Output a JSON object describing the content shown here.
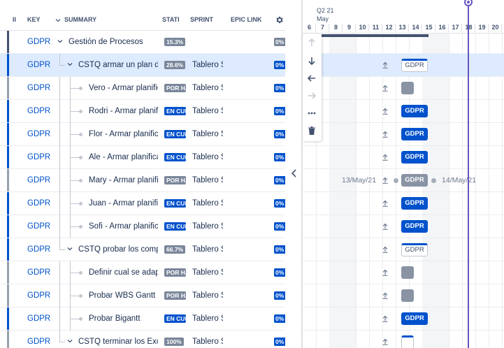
{
  "columns": {
    "first": "II",
    "key": "KEY",
    "summary": "SUMMARY",
    "status": "STATI",
    "sprint": "SPRINT",
    "epic_link": "EPIC LINK"
  },
  "rows": [
    {
      "key": "GDPR",
      "summary": "Gestión de Procesos",
      "status": "15.3%",
      "status_color": "gray",
      "sprint": "",
      "pct": "0%",
      "level": 0,
      "bar": "dark",
      "expanded": true
    },
    {
      "key": "GDPR",
      "summary": "CSTQ armar un plan de",
      "status": "28.6%",
      "status_color": "gray",
      "sprint": "Tablero S",
      "pct": "0%",
      "level": 1,
      "bar": "blue",
      "expanded": true,
      "selected": true
    },
    {
      "key": "GDPR",
      "summary": "Vero - Armar planific",
      "status": "POR HA",
      "status_color": "gray",
      "sprint": "Tablero S",
      "pct": "0%",
      "level": 2,
      "bar": "gray"
    },
    {
      "key": "GDPR",
      "summary": "Rodri - Armar planifi",
      "status": "EN CUI",
      "status_color": "blue",
      "sprint": "Tablero S",
      "pct": "0%",
      "level": 2,
      "bar": "blue"
    },
    {
      "key": "GDPR",
      "summary": "Flor - Armar planifica",
      "status": "EN CUI",
      "status_color": "blue",
      "sprint": "Tablero S",
      "pct": "0%",
      "level": 2,
      "bar": "blue"
    },
    {
      "key": "GDPR",
      "summary": "Ale - Armar planifica",
      "status": "EN CUI",
      "status_color": "blue",
      "sprint": "Tablero S",
      "pct": "0%",
      "level": 2,
      "bar": "blue"
    },
    {
      "key": "GDPR",
      "summary": "Mary - Armar planific",
      "status": "POR HA",
      "status_color": "gray",
      "sprint": "Tablero S",
      "pct": "0%",
      "level": 2,
      "bar": "gray"
    },
    {
      "key": "GDPR",
      "summary": "Juan - Armar planifi",
      "status": "EN CUI",
      "status_color": "blue",
      "sprint": "Tablero S",
      "pct": "0%",
      "level": 2,
      "bar": "blue"
    },
    {
      "key": "GDPR",
      "summary": "Sofi - Armar planific",
      "status": "EN CUI",
      "status_color": "blue",
      "sprint": "Tablero S",
      "pct": "0%",
      "level": 2,
      "bar": "blue"
    },
    {
      "key": "GDPR",
      "summary": "CSTQ probar los compl",
      "status": "66.7%",
      "status_color": "gray",
      "sprint": "Tablero S",
      "pct": "0%",
      "level": 1,
      "bar": "blue",
      "expanded": true
    },
    {
      "key": "GDPR",
      "summary": "Definir cual se adap",
      "status": "POR HA",
      "status_color": "gray",
      "sprint": "Tablero S",
      "pct": "0%",
      "level": 2,
      "bar": "gray"
    },
    {
      "key": "GDPR",
      "summary": "Probar WBS Gantt",
      "status": "POR HA",
      "status_color": "gray",
      "sprint": "Tablero S",
      "pct": "0%",
      "level": 2,
      "bar": "gray"
    },
    {
      "key": "GDPR",
      "summary": "Probar Bigantt",
      "status": "EN CUI",
      "status_color": "blue",
      "sprint": "Tablero S",
      "pct": "0%",
      "level": 2,
      "bar": "blue"
    },
    {
      "key": "GDPR",
      "summary": "CSTQ terminar los Exce",
      "status": "100%",
      "status_color": "gray",
      "sprint": "Tablero S",
      "pct": "0%",
      "level": 1,
      "bar": "gray",
      "expanded": true
    }
  ],
  "timeline": {
    "quarter": "Q2 21",
    "month": "May",
    "days": [
      "6",
      "7",
      "8",
      "9",
      "10",
      "11",
      "12",
      "13",
      "14",
      "15",
      "16",
      "17",
      "18",
      "19",
      "20"
    ],
    "weekend_days": [
      "8",
      "9",
      "15",
      "16"
    ],
    "today_day": "18",
    "bars": [
      {
        "row": 1,
        "label": "GDPR",
        "style": "outline"
      },
      {
        "row": 2,
        "label": "",
        "style": "gray-square"
      },
      {
        "row": 3,
        "label": "GDPR",
        "style": "blue"
      },
      {
        "row": 4,
        "label": "GDPR",
        "style": "blue"
      },
      {
        "row": 5,
        "label": "GDPR",
        "style": "blue"
      },
      {
        "row": 6,
        "label": "GDPR",
        "style": "gray",
        "start_label": "13/May/21",
        "end_label": "14/May/21"
      },
      {
        "row": 7,
        "label": "GDPR",
        "style": "blue"
      },
      {
        "row": 8,
        "label": "GDPR",
        "style": "blue"
      },
      {
        "row": 9,
        "label": "GDPR",
        "style": "outline"
      },
      {
        "row": 10,
        "label": "",
        "style": "gray-square"
      },
      {
        "row": 11,
        "label": "",
        "style": "gray-square"
      },
      {
        "row": 12,
        "label": "GDPR",
        "style": "blue"
      },
      {
        "row": 13,
        "label": "",
        "style": "outline-square"
      }
    ]
  },
  "colors": {
    "accent": "#0052cc",
    "today": "#6554c0",
    "selected_row": "#deebff",
    "status_gray": "#7a869a"
  },
  "icons": {
    "settings": "gear-icon",
    "move_up": "arrow-up-icon",
    "move_down": "arrow-down-icon",
    "outdent": "arrow-left-icon",
    "indent": "arrow-right-icon",
    "more": "more-icon",
    "delete": "trash-icon",
    "collapse": "chevron-left-icon"
  }
}
